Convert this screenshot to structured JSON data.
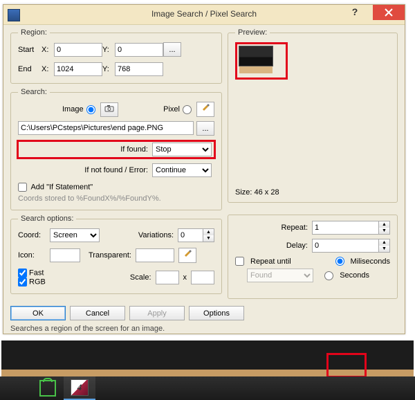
{
  "window": {
    "title": "Image Search / Pixel Search"
  },
  "region": {
    "legend": "Region:",
    "start_label": "Start",
    "end_label": "End",
    "x_label": "X:",
    "y_label": "Y:",
    "start_x": "0",
    "start_y": "0",
    "end_x": "1024",
    "end_y": "768",
    "browse_label": "..."
  },
  "search": {
    "legend": "Search:",
    "image_label": "Image",
    "pixel_label": "Pixel",
    "path": "C:\\Users\\PCsteps\\Pictures\\end page.PNG",
    "browse_label": "...",
    "if_found_label": "If found:",
    "if_found_value": "Stop",
    "if_not_found_label": "If not found / Error:",
    "if_not_found_value": "Continue",
    "add_if_label": "Add \"If Statement\"",
    "hint": "Coords stored to %FoundX%/%FoundY%."
  },
  "search_options": {
    "legend": "Search options:",
    "coord_label": "Coord:",
    "coord_value": "Screen",
    "variations_label": "Variations:",
    "variations_value": "0",
    "icon_label": "Icon:",
    "transparent_label": "Transparent:",
    "scale_label": "Scale:",
    "scale_sep": "x",
    "fast_label": "Fast",
    "rgb_label": "RGB"
  },
  "preview": {
    "legend": "Preview:",
    "size_label": "Size: 46 x 28"
  },
  "repeat": {
    "repeat_label": "Repeat:",
    "repeat_value": "1",
    "delay_label": "Delay:",
    "delay_value": "0",
    "repeat_until_label": "Repeat until",
    "repeat_until_value": "Found",
    "miliseconds_label": "Miliseconds",
    "seconds_label": "Seconds"
  },
  "buttons": {
    "ok": "OK",
    "cancel": "Cancel",
    "apply": "Apply",
    "options": "Options"
  },
  "status": "Searches a region of the screen for an image.",
  "taskbar": {
    "app_glyph": "4"
  }
}
